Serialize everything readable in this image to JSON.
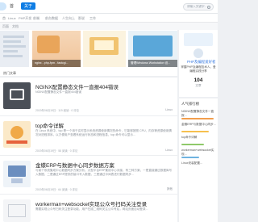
{
  "topbar": {
    "home_label": "首",
    "about_label": "关于",
    "search_placeholder": "请输入关键字..."
  },
  "categories": [
    "首",
    "Linux",
    "PHP开发",
    "前端",
    "前台数据",
    "人生向上",
    "那说",
    "工作"
  ],
  "subnav": [
    "页面",
    "文档"
  ],
  "banner": {
    "items": [
      {
        "caption": ""
      },
      {
        "caption": "nginx - php-fpm - fastcgi..."
      },
      {
        "caption": ""
      },
      {
        "caption": "管理Windows Workstation 设..."
      }
    ]
  },
  "section_title": "热门文章",
  "articles": [
    {
      "title": "NGINX配置静态文件一直报404错误",
      "desc": "NGINX配置静态文件一直报404错误",
      "meta": "2019年06月19日 · 119 阅读 · 0 评论",
      "tag": "Linux"
    },
    {
      "title": "top命令详解",
      "desc": "在 Linux 系统中，top 是一个用于实时显示系统资源使用情况的命令，它能够按照 CPU、内存等资源使用情况对进程排序，以方便用户查看系统运行状态和进程信息，top 命令可以显示...",
      "meta": "2019年06月19日 · 58 阅读 · 0 评论",
      "tag": "Linux"
    },
    {
      "title": "金蝶ERP与数据中心同步数据方案",
      "desc": "与某个系统集成中心数据同步方案分析。大型平台ERP集成中心对接，有三种方案，一是直接通过数据库写入数据，二是通过ERP提供的接口写入数据，三是通过中间表进行数据同步...",
      "meta": "2019年06月19日 · 64 阅读 · 0 评论",
      "tag": "其他"
    },
    {
      "title": "workerman+websocket实现公众号扫码关注登录",
      "desc": "需要实现公众号扫码关注登录功能，用户扫描二维码关注公众号后，网站页面自动登录...",
      "meta": "",
      "tag": ""
    }
  ],
  "sidebar": {
    "author_name": "PHP及编程爱好者",
    "author_bio": "掌握PHP及编程技术人，爱编程实践分享",
    "post_count": "104",
    "post_count_label": "文章",
    "hot_title": "人气排行榜",
    "hot_items": [
      "NGINX配置静态文件一直报...",
      "金蝶ERP与数据中心同步...",
      "top命令详解",
      "workerman+websocket实现...",
      "Linux安装配置..."
    ]
  },
  "colors": {
    "accent": "#0f7de4",
    "link": "#3a7be0",
    "bg": "#eef0f3"
  }
}
